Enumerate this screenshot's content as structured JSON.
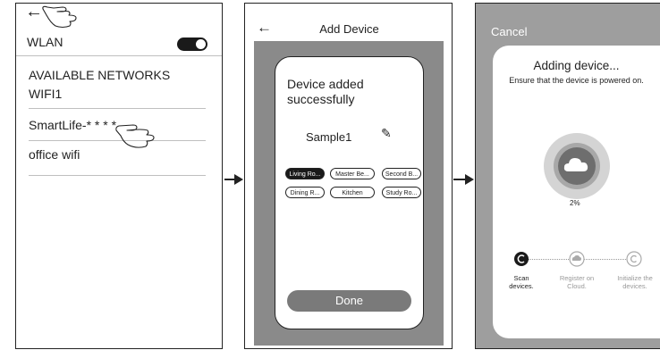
{
  "screen1": {
    "back_icon": "←",
    "wlan_label": "WLAN",
    "wlan_enabled": true,
    "section_header": "AVAILABLE NETWORKS",
    "networks": [
      "WIFI1",
      "SmartLife-* * * *",
      "office wifi"
    ]
  },
  "screen2": {
    "back_icon": "←",
    "title": "Add Device",
    "success_message": "Device added successfully",
    "device_name": "Sample1",
    "edit_icon": "✎",
    "rooms": [
      "Living Ro...",
      "Master Be...",
      "Second B...",
      "Dining R...",
      "Kitchen",
      "Study Ro..."
    ],
    "selected_room": "Living Ro...",
    "done_label": "Done"
  },
  "screen3": {
    "cancel_label": "Cancel",
    "heading": "Adding device...",
    "subheading": "Ensure that the device is powered on.",
    "progress_text": "2%",
    "progress_fraction": 0.02,
    "steps": [
      {
        "label_line1": "Scan",
        "label_line2": "devices.",
        "active": true
      },
      {
        "label_line1": "Register on",
        "label_line2": "Cloud.",
        "active": false
      },
      {
        "label_line1": "Initialize the",
        "label_line2": "devices.",
        "active": false
      }
    ]
  },
  "colors": {
    "dark": "#1a1a1a",
    "panel_gray": "#8a8a8a",
    "screen3_bg": "#9e9e9e",
    "muted_text": "#999999"
  }
}
